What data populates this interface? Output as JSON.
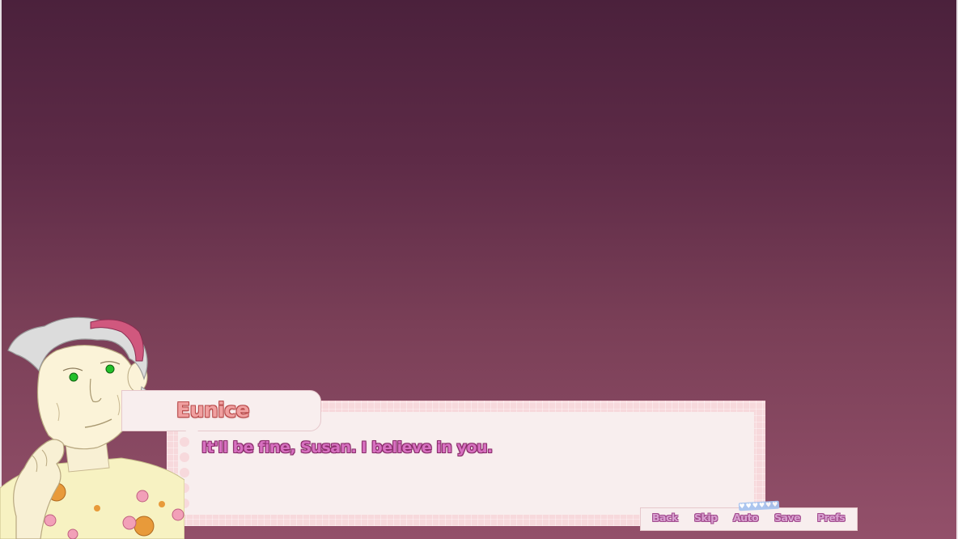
{
  "dialogue": {
    "speaker": "Eunice",
    "line": "It'll be fine, Susan. I believe in you."
  },
  "quick_menu": {
    "items": [
      "Back",
      "Skip",
      "Auto",
      "Save",
      "Prefs"
    ]
  },
  "character": {
    "name": "Eunice",
    "eye_color": "#22c02a",
    "headband_color": "#c9527a",
    "hair_color": "#cfcfcf"
  },
  "colors": {
    "background_top": "#4b213c",
    "background_bottom": "#93506a",
    "dialogue_text": "#d770c0",
    "name_text": "#f0a0a0",
    "box_border": "#f7d9dc",
    "box_paper": "#f8eeee"
  }
}
